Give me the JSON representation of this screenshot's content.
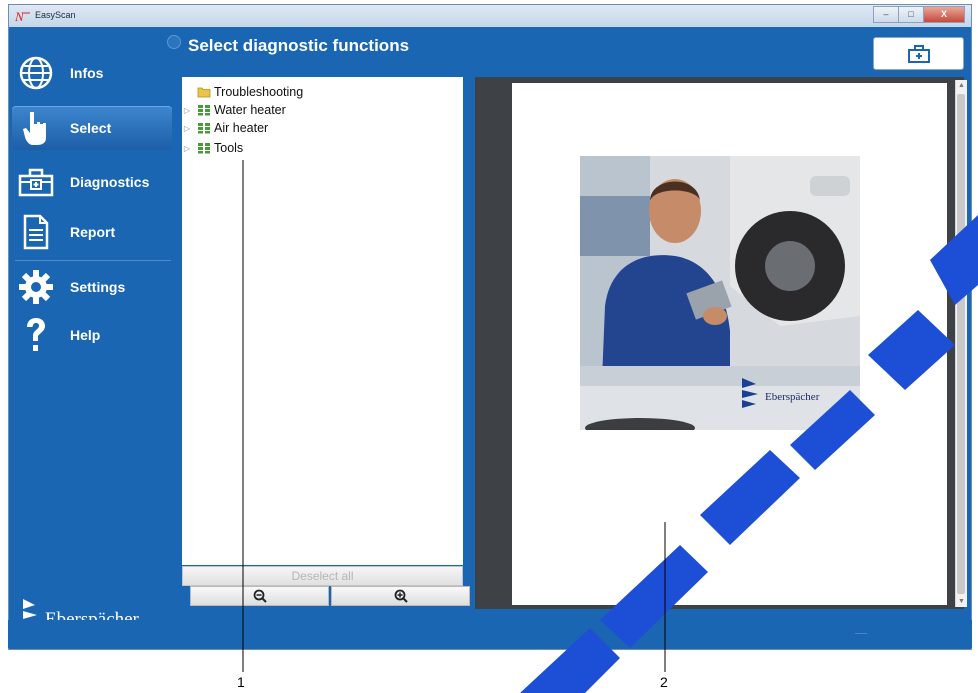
{
  "window": {
    "title": "EasyScan",
    "controls": {
      "minimize": "–",
      "maximize": "□",
      "close": "X"
    }
  },
  "sidebar": {
    "items": [
      {
        "label": "Infos",
        "icon": "globe-icon",
        "active": false
      },
      {
        "label": "Select",
        "icon": "hand-pointer-icon",
        "active": true
      },
      {
        "label": "Diagnostics",
        "icon": "toolbox-icon",
        "active": false
      },
      {
        "label": "Report",
        "icon": "document-icon",
        "active": false
      },
      {
        "label": "Settings",
        "icon": "gear-icon",
        "active": false
      },
      {
        "label": "Help",
        "icon": "question-icon",
        "active": false
      }
    ],
    "brand": "Eberspächer"
  },
  "header": {
    "title": "Select diagnostic functions",
    "action_icon": "toolbox-icon"
  },
  "tree": {
    "items": [
      {
        "label": "Troubleshooting",
        "icon": "folder-icon",
        "expandable": false
      },
      {
        "label": "Water heater",
        "icon": "module-grid-icon",
        "expandable": true
      },
      {
        "label": "Air heater",
        "icon": "module-grid-icon",
        "expandable": true
      },
      {
        "label": "Tools",
        "icon": "module-grid-icon",
        "expandable": true
      }
    ],
    "deselect_label": "Deselect all",
    "zoom_out_icon": "zoom-out-icon",
    "zoom_in_icon": "zoom-in-icon"
  },
  "preview": {
    "logo_text": "Eberspächer"
  },
  "callouts": [
    "1",
    "2"
  ],
  "colors": {
    "primary": "#1a66b3",
    "active": "#2f7bc6",
    "watermark": "#1d4fd6"
  }
}
